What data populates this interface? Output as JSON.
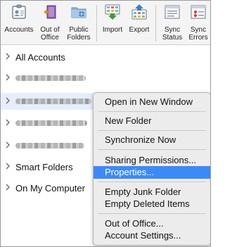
{
  "toolbar": {
    "buttons": [
      {
        "label": "Accounts",
        "icon": "accounts-icon"
      },
      {
        "label": "Out of\nOffice",
        "icon": "out-of-office-icon"
      },
      {
        "label": "Public\nFolders",
        "icon": "public-folders-icon"
      },
      {
        "label": "Import",
        "icon": "import-icon"
      },
      {
        "label": "Export",
        "icon": "export-icon"
      },
      {
        "label": "Sync\nStatus",
        "icon": "sync-status-icon"
      },
      {
        "label": "Sync\nErrors",
        "icon": "sync-errors-icon"
      }
    ]
  },
  "folders": {
    "all_accounts": "All Accounts",
    "smart_folders": "Smart Folders",
    "on_my_computer": "On My Computer"
  },
  "menu": {
    "open_new_window": "Open in New Window",
    "new_folder": "New Folder",
    "synchronize_now": "Synchronize Now",
    "sharing_permissions": "Sharing Permissions...",
    "properties": "Properties...",
    "empty_junk": "Empty Junk Folder",
    "empty_deleted": "Empty Deleted Items",
    "out_of_office": "Out of Office...",
    "account_settings": "Account Settings..."
  },
  "colors": {
    "highlight": "#3d8af7",
    "selection": "#e6eefb"
  }
}
